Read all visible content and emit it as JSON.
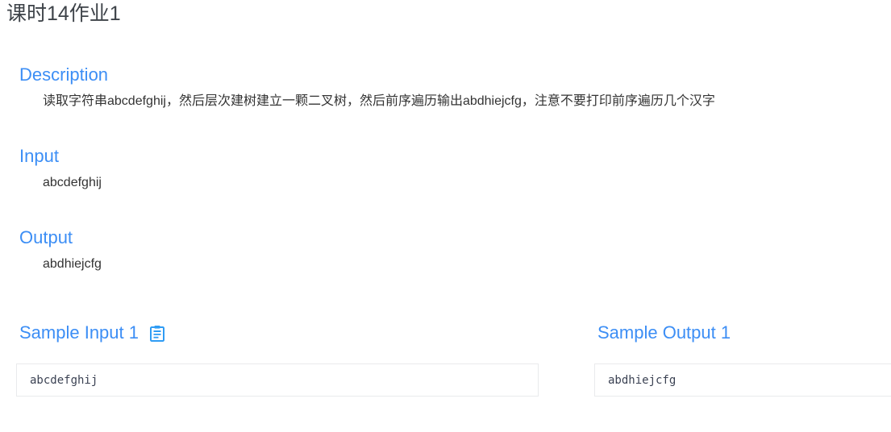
{
  "problem": {
    "title": "课时14作业1"
  },
  "sections": [
    {
      "heading": "Description",
      "body": "读取字符串abcdefghij，然后层次建树建立一颗二叉树，然后前序遍历输出abdhiejcfg，注意不要打印前序遍历几个汉字"
    },
    {
      "heading": "Input",
      "body": "abcdefghij"
    },
    {
      "heading": "Output",
      "body": "abdhiejcfg"
    }
  ],
  "samples": {
    "input": {
      "heading": "Sample Input 1",
      "copy_icon": "clipboard-copy-icon",
      "text": "abcdefghij"
    },
    "output": {
      "heading": "Sample Output 1",
      "text": "abdhiejcfg"
    }
  },
  "colors": {
    "accent_blue": "#3c8ef5",
    "title_gray": "#3e4349",
    "body_gray": "#333333",
    "box_border": "#e9eaec",
    "code_text": "#3b4253"
  }
}
